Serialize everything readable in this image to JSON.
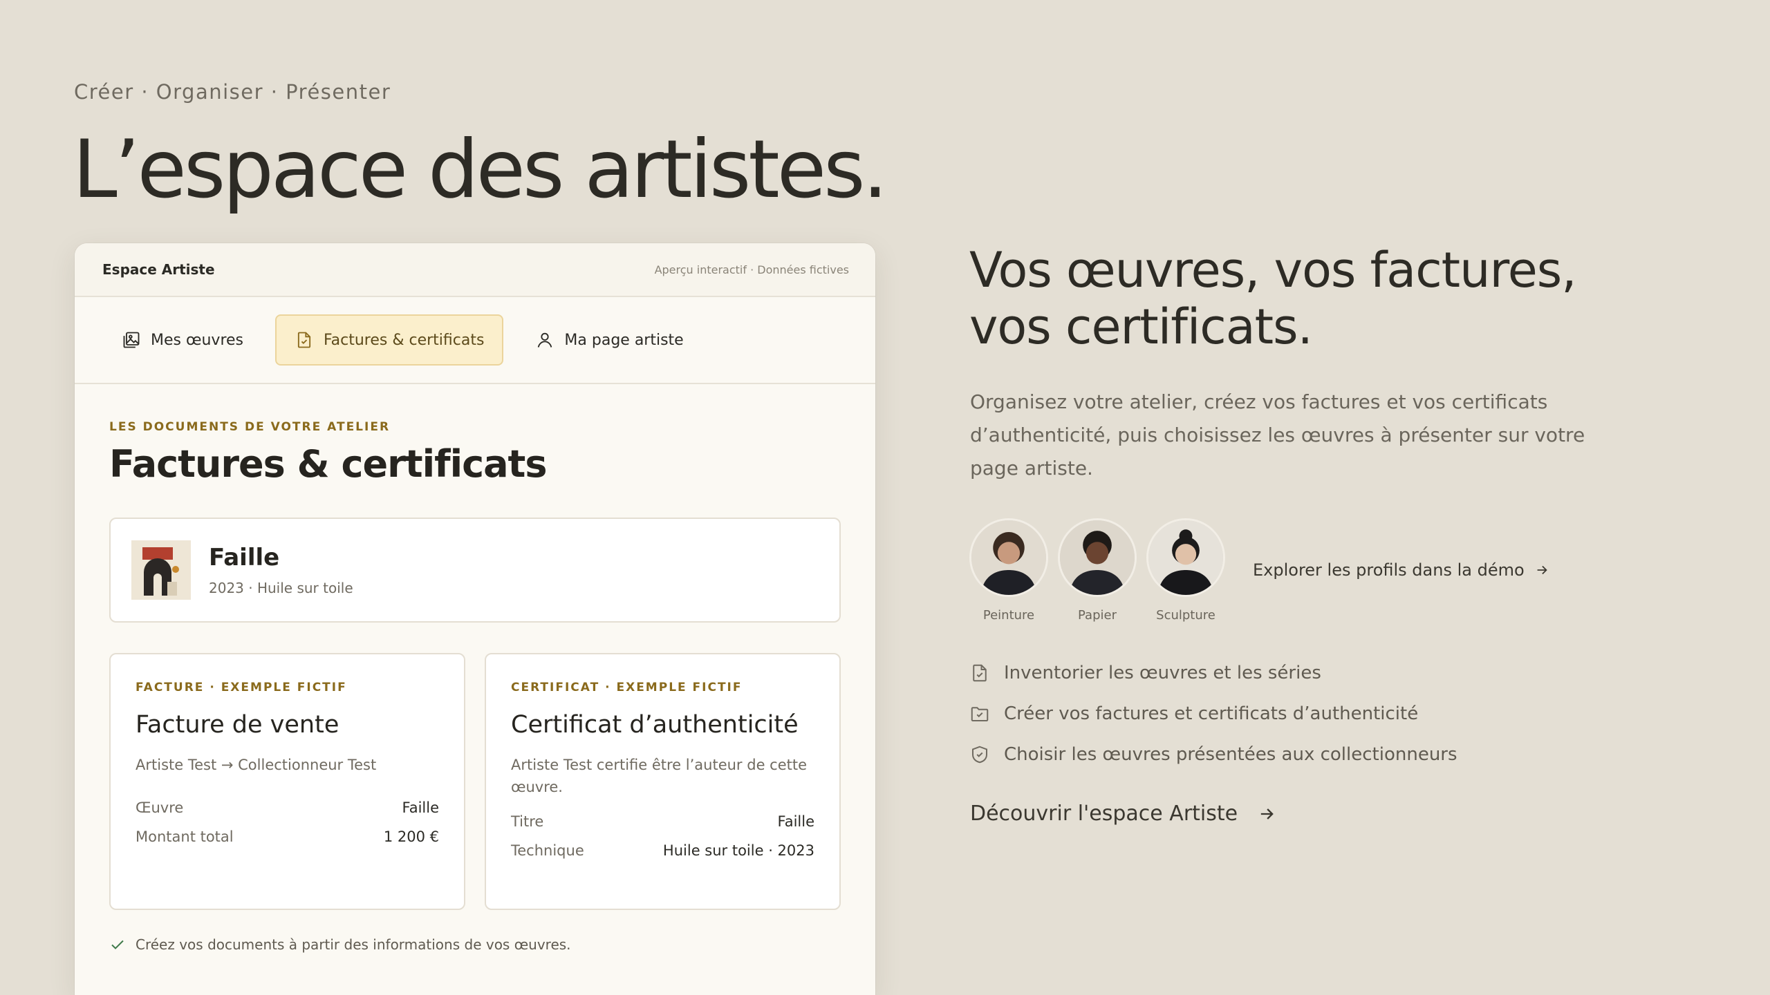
{
  "hero": {
    "eyebrow": "Créer · Organiser · Présenter",
    "title": "L’espace des artistes."
  },
  "demo_card": {
    "brand": "Espace Artiste",
    "note": "Aperçu interactif · Données fictives",
    "tabs": [
      {
        "label": "Mes œuvres",
        "icon": "artworks-icon",
        "active": false
      },
      {
        "label": "Factures & certificats",
        "icon": "document-icon",
        "active": true
      },
      {
        "label": "Ma page artiste",
        "icon": "user-icon",
        "active": false
      }
    ],
    "section_eyebrow": "LES DOCUMENTS DE VOTRE ATELIER",
    "section_title": "Factures & certificats",
    "artwork": {
      "name": "Faille",
      "meta": "2023 · Huile sur toile"
    },
    "invoice": {
      "eyebrow": "FACTURE · EXEMPLE FICTIF",
      "title": "Facture de vente",
      "desc": "Artiste Test → Collectionneur Test",
      "rows": [
        {
          "label": "Œuvre",
          "value": "Faille"
        },
        {
          "label": "Montant total",
          "value": "1 200 €"
        }
      ]
    },
    "certificate": {
      "eyebrow": "CERTIFICAT · EXEMPLE FICTIF",
      "title": "Certificat d’authenticité",
      "desc": "Artiste Test certifie être l’auteur de cette œuvre.",
      "rows": [
        {
          "label": "Titre",
          "value": "Faille"
        },
        {
          "label": "Technique",
          "value": "Huile sur toile · 2023"
        }
      ]
    },
    "footer_note": "Créez vos documents à partir des informations de vos œuvres."
  },
  "right": {
    "title": "Vos œuvres, vos factures, vos certificats.",
    "description": "Organisez votre atelier, créez vos factures et vos certificats d’authenticité, puis choisissez les œuvres à présenter sur votre page artiste.",
    "profiles": [
      {
        "label": "Peinture"
      },
      {
        "label": "Papier"
      },
      {
        "label": "Sculpture"
      }
    ],
    "explore_link": "Explorer les profils dans la démo",
    "features": [
      {
        "label": "Inventorier les œuvres et les séries",
        "icon": "document-icon"
      },
      {
        "label": "Créer vos factures et certificats d’authenticité",
        "icon": "folder-icon"
      },
      {
        "label": "Choisir les œuvres présentées aux collectionneurs",
        "icon": "shield-check-icon"
      }
    ],
    "cta": "Découvrir l'espace Artiste"
  },
  "colors": {
    "background": "#e4dfd4",
    "accent_gold": "#8a6a1c",
    "active_tab": "#fbefcc"
  }
}
